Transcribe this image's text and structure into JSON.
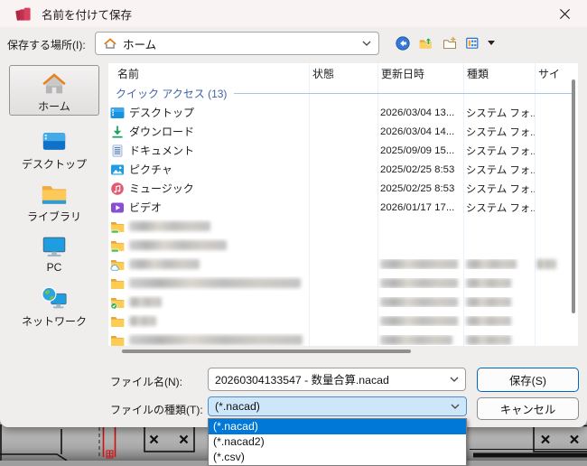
{
  "window": {
    "title": "名前を付けて保存"
  },
  "location_bar": {
    "label": "保存する場所(I):",
    "value": "ホーム"
  },
  "toolbar": {
    "buttons": [
      {
        "id": "back",
        "icon": "back"
      },
      {
        "id": "up-one-level",
        "icon": "up-folder"
      },
      {
        "id": "new-folder",
        "icon": "new-folder"
      },
      {
        "id": "view-menu",
        "icon": "views",
        "has_caret": true
      }
    ]
  },
  "sidebar": {
    "items": [
      {
        "id": "home",
        "label": "ホーム",
        "icon": "home-large",
        "selected": true
      },
      {
        "id": "desktop",
        "label": "デスクトップ",
        "icon": "desktop-large",
        "selected": false
      },
      {
        "id": "library",
        "label": "ライブラリ",
        "icon": "library-large",
        "selected": false
      },
      {
        "id": "pc",
        "label": "PC",
        "icon": "pc-large",
        "selected": false
      },
      {
        "id": "network",
        "label": "ネットワーク",
        "icon": "network-large",
        "selected": false
      }
    ]
  },
  "file_list": {
    "columns": [
      "名前",
      "状態",
      "更新日時",
      "種類",
      "サイ"
    ],
    "group_header": "クイック アクセス (13)",
    "rows": [
      {
        "icon": "desktop",
        "name": "デスクトップ",
        "date": "2026/03/04 13...",
        "type": "システム フォ..."
      },
      {
        "icon": "download",
        "name": "ダウンロード",
        "date": "2026/03/04 14...",
        "type": "システム フォ..."
      },
      {
        "icon": "document",
        "name": "ドキュメント",
        "date": "2025/09/09 15...",
        "type": "システム フォ..."
      },
      {
        "icon": "pictures",
        "name": "ピクチャ",
        "date": "2025/02/25 8:53",
        "type": "システム フォ..."
      },
      {
        "icon": "music",
        "name": "ミュージック",
        "date": "2025/02/25 8:53",
        "type": "システム フォ..."
      },
      {
        "icon": "videos",
        "name": "ビデオ",
        "date": "2026/01/17 17...",
        "type": "システム フォ..."
      },
      {
        "icon": "folder-sync",
        "redacted": {
          "name": 90
        }
      },
      {
        "icon": "folder-sync",
        "redacted": {
          "name": 108
        }
      },
      {
        "icon": "folder-cloud",
        "redacted": {
          "name": 78,
          "date": 86,
          "type": 56,
          "size": 22
        }
      },
      {
        "icon": "folder",
        "redacted": {
          "name": 190,
          "date": 86,
          "type": 50
        }
      },
      {
        "icon": "folder-check",
        "redacted": {
          "name": 36,
          "date": 86,
          "type": 50
        }
      },
      {
        "icon": "folder",
        "redacted": {
          "name": 30,
          "date": 86,
          "type": 50
        }
      },
      {
        "icon": "folder",
        "redacted": {
          "name": 192,
          "date": 80,
          "type": 50
        }
      }
    ]
  },
  "fields": {
    "file_name_label": "ファイル名(N):",
    "file_name_value": "20260304133547 - 数量合算.nacad",
    "file_type_label": "ファイルの種類(T):",
    "file_type_value": "(*.nacad)"
  },
  "buttons": {
    "save": "保存(S)",
    "cancel": "キャンセル"
  },
  "file_type_dropdown": {
    "options": [
      {
        "label": "(*.nacad)",
        "selected": true
      },
      {
        "label": "(*.nacad2)",
        "selected": false
      },
      {
        "label": "(*.csv)",
        "selected": false
      }
    ]
  },
  "colors": {
    "accent": "#0078d7",
    "group_header_text": "#4063a8",
    "group_line": "#a9c4e4",
    "save_border": "#0067c0"
  }
}
